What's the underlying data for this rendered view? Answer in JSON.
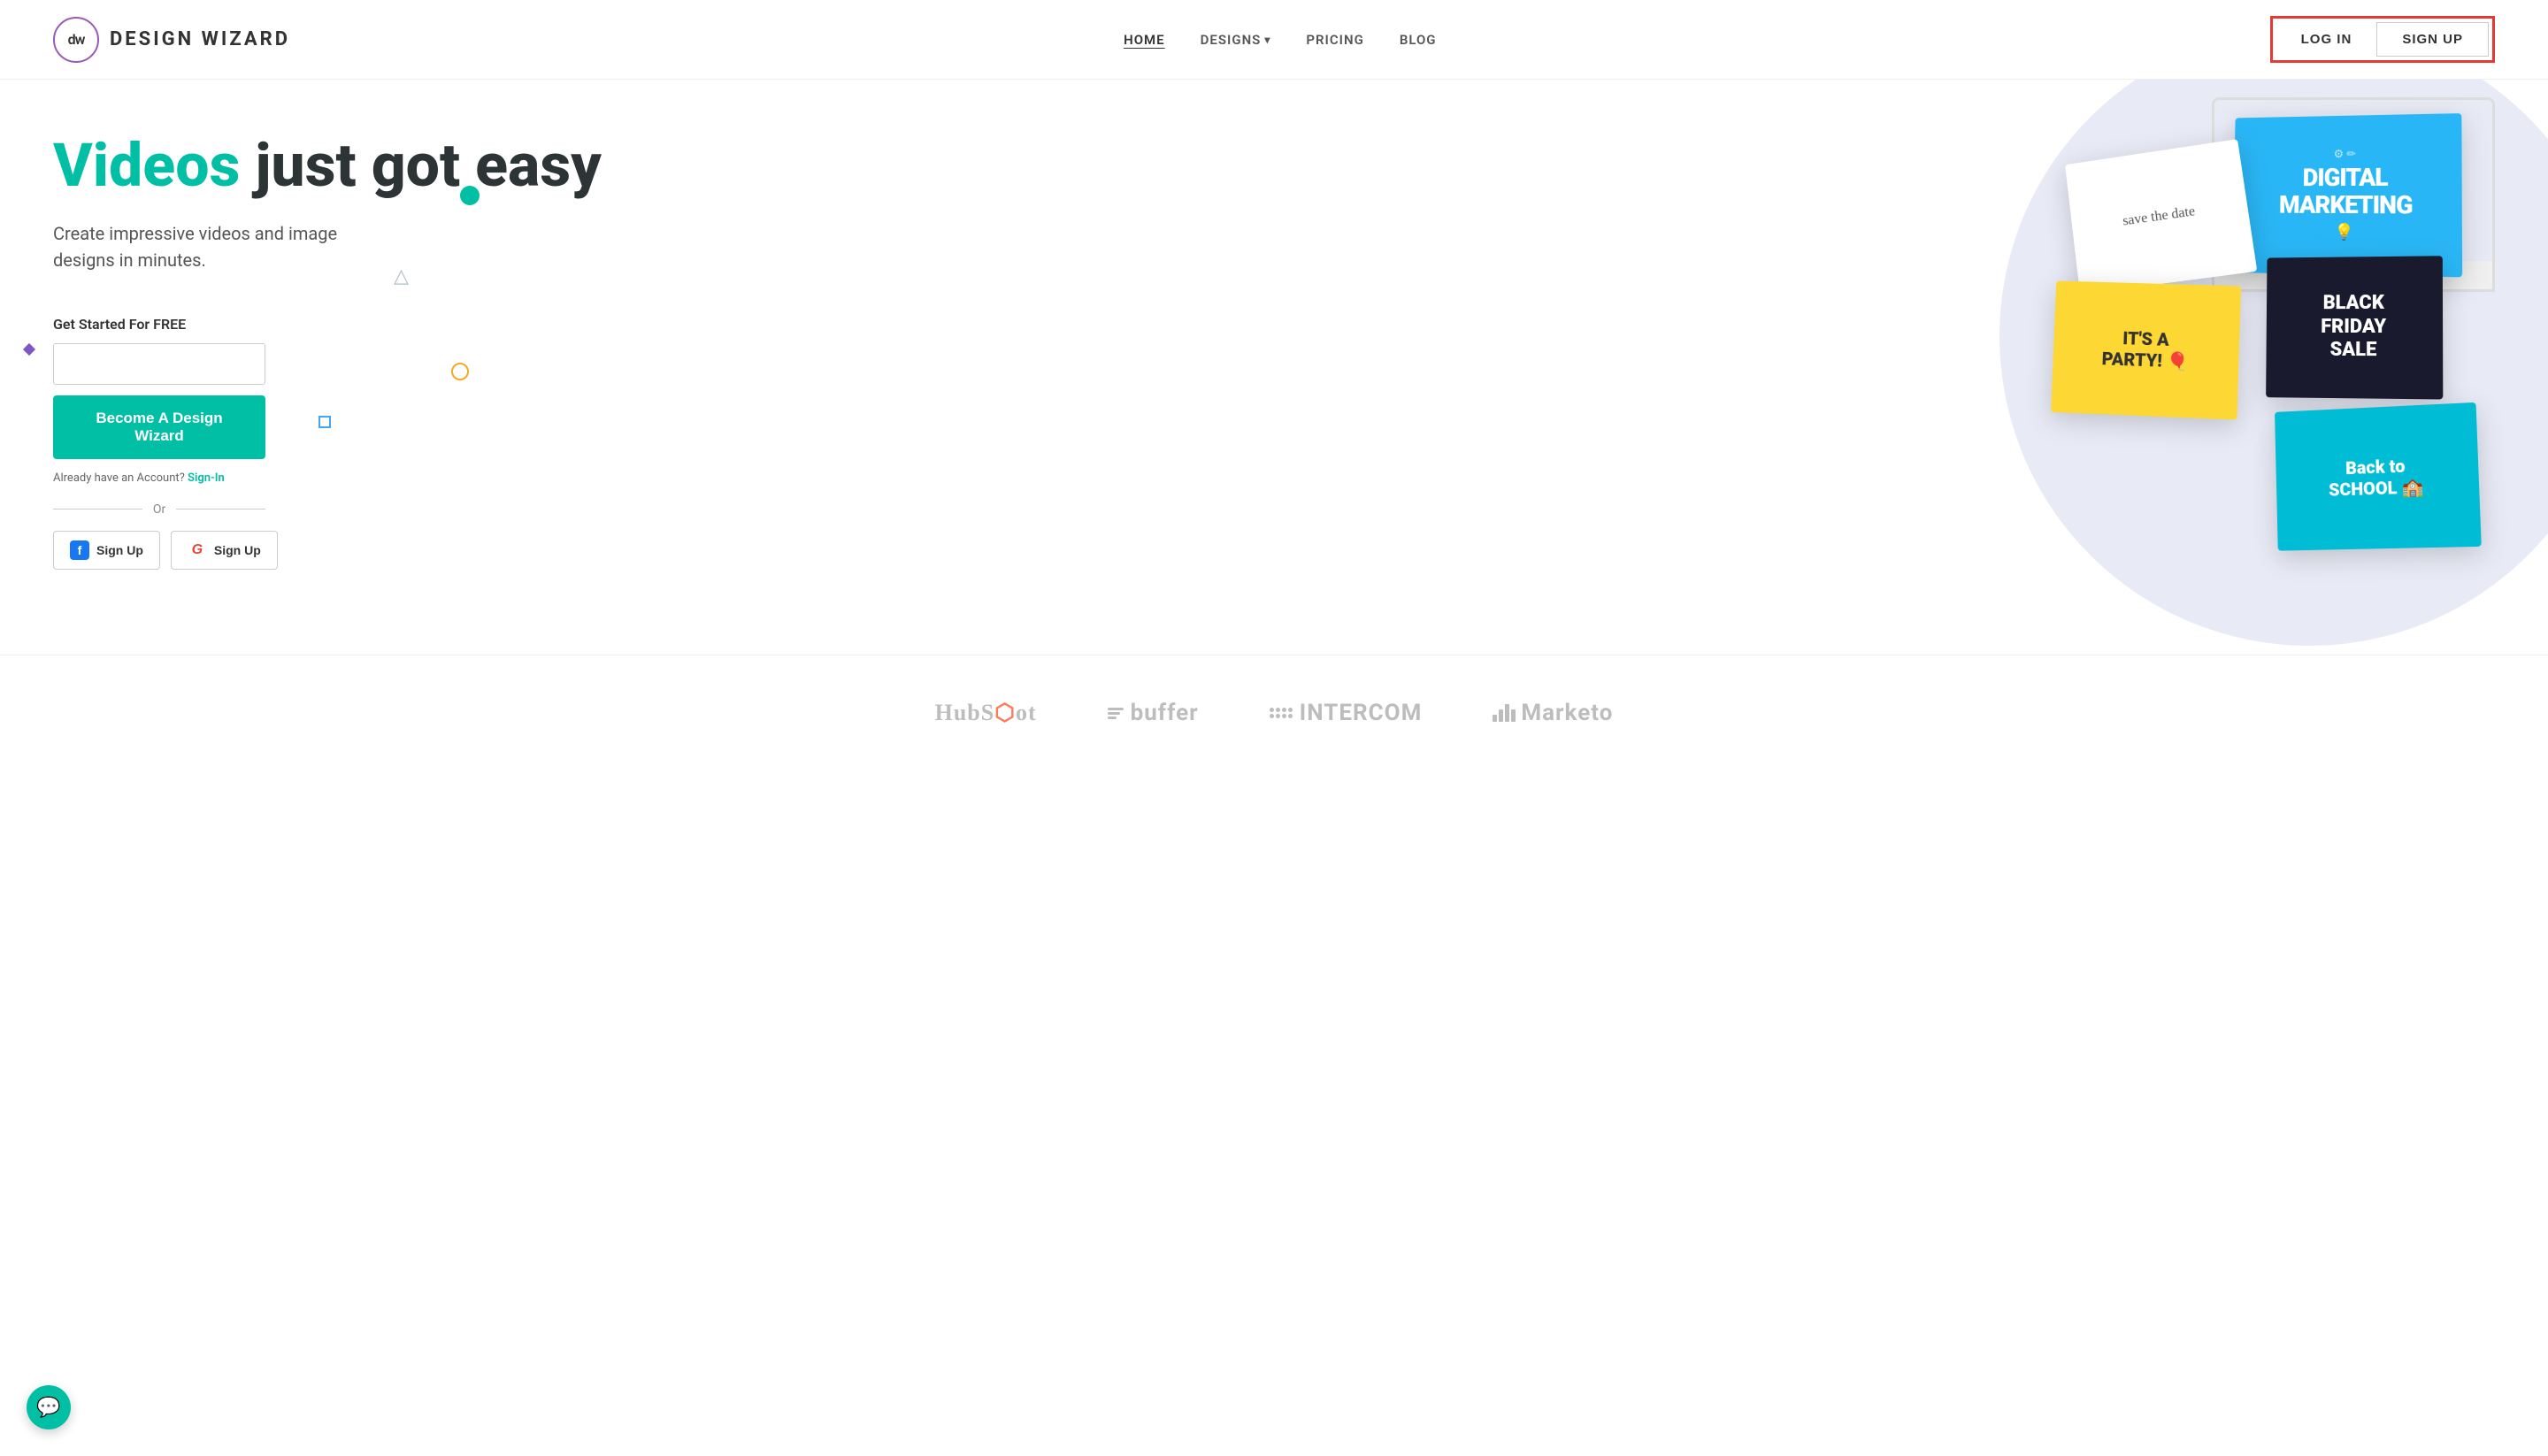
{
  "header": {
    "logo_letters": "dw",
    "logo_title": "DESIGN WIZARD",
    "nav": {
      "home": "HOME",
      "designs": "DESIGNS",
      "pricing": "PRICING",
      "blog": "BLOG"
    },
    "auth": {
      "login": "LOG IN",
      "signup": "SIGN UP"
    }
  },
  "hero": {
    "title_highlight": "Videos",
    "title_rest": " just got easy",
    "subtitle": "Create impressive videos and image designs in minutes.",
    "get_started_label": "Get Started For FREE",
    "email_placeholder": "",
    "cta_button": "Become A Design Wizard",
    "already_account": "Already have an Account?",
    "sign_in_link": "Sign-In",
    "or_text": "Or",
    "facebook_signup": "Sign Up",
    "google_signup": "Sign Up"
  },
  "cards": {
    "digital_marketing": "DIGITAL\nMARKETING",
    "save_the_date": "save the date",
    "party": "IT'S A\nPARTY!",
    "black_friday": "BLACK\nFRIDAY\nSALE",
    "back_to_school": "Back to\nSCHOOL"
  },
  "brands": {
    "items": [
      {
        "name": "HubSpot",
        "id": "hubspot"
      },
      {
        "name": "buffer",
        "id": "buffer"
      },
      {
        "name": "INTERCOM",
        "id": "intercom"
      },
      {
        "name": "Marketo",
        "id": "marketo"
      }
    ]
  },
  "colors": {
    "teal": "#00bfa5",
    "red_border": "#e53935",
    "dark": "#2d3436",
    "gray": "#bdbdbd"
  }
}
